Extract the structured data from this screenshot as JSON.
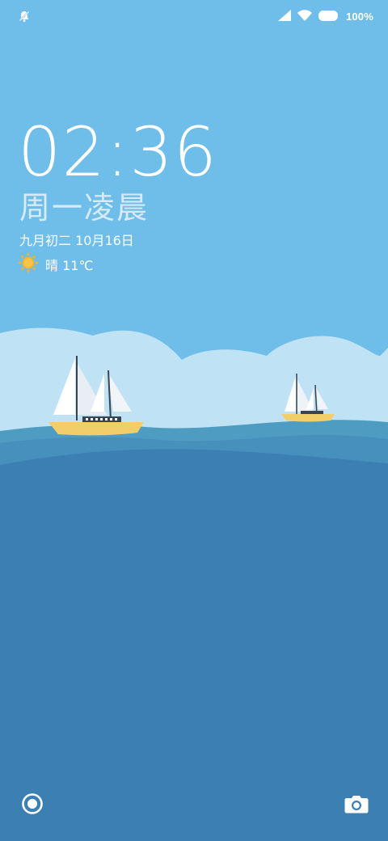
{
  "status_bar": {
    "left_icon": "notification-bell-muted-icon",
    "signal_icon": "cell-signal-icon",
    "wifi_icon": "wifi-icon",
    "battery_icon": "battery-icon",
    "battery_text": "100%"
  },
  "lockscreen": {
    "time": "02:36",
    "day_period": "周一凌晨",
    "date": "九月初二  10月16日",
    "weather": {
      "icon": "sun-icon",
      "text": "晴  11℃"
    }
  },
  "bottom_actions": {
    "left_icon": "voice-assistant-icon",
    "right_icon": "camera-icon"
  },
  "colors": {
    "sky": "#6fbde9",
    "clouds": "#bfe3f5",
    "sea_deep": "#3c7fb3",
    "sea_light": "#4f9cc2",
    "sun": "#f5b52a",
    "sail": "#ffffff",
    "hull": "#f2ce6a"
  }
}
